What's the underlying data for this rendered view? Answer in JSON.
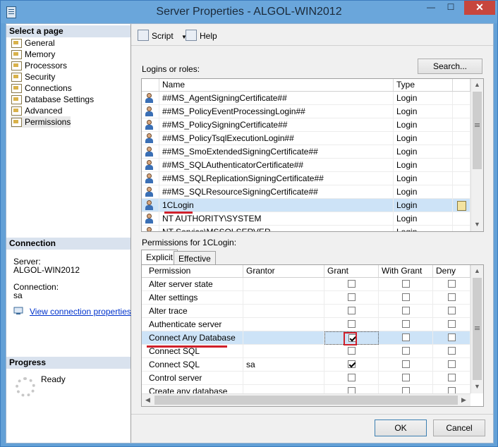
{
  "window": {
    "title": "Server Properties - ALGOL-WIN2012",
    "minimize": "—",
    "maximize": "☐",
    "close": "✕"
  },
  "left_panel": {
    "select_page_header": "Select a page",
    "pages": [
      "General",
      "Memory",
      "Processors",
      "Security",
      "Connections",
      "Database Settings",
      "Advanced",
      "Permissions"
    ],
    "selected_page": "Permissions",
    "connection_header": "Connection",
    "server_label": "Server:",
    "server_value": "ALGOL-WIN2012",
    "connection_label": "Connection:",
    "connection_value": "sa",
    "view_link": "View connection properties",
    "progress_header": "Progress",
    "progress_status": "Ready"
  },
  "toolbar": {
    "script_label": "Script",
    "help_label": "Help"
  },
  "logins": {
    "section_label": "Logins or roles:",
    "search_button": "Search...",
    "columns": [
      "Name",
      "Type"
    ],
    "rows": [
      {
        "name": "##MS_AgentSigningCertificate##",
        "type": "Login"
      },
      {
        "name": "##MS_PolicyEventProcessingLogin##",
        "type": "Login"
      },
      {
        "name": "##MS_PolicySigningCertificate##",
        "type": "Login"
      },
      {
        "name": "##MS_PolicyTsqlExecutionLogin##",
        "type": "Login"
      },
      {
        "name": "##MS_SmoExtendedSigningCertificate##",
        "type": "Login"
      },
      {
        "name": "##MS_SQLAuthenticatorCertificate##",
        "type": "Login"
      },
      {
        "name": "##MS_SQLReplicationSigningCertificate##",
        "type": "Login"
      },
      {
        "name": "##MS_SQLResourceSigningCertificate##",
        "type": "Login"
      },
      {
        "name": "1CLogin",
        "type": "Login"
      },
      {
        "name": "NT AUTHORITY\\SYSTEM",
        "type": "Login"
      },
      {
        "name": "NT Service\\MSSQLSERVER",
        "type": "Login"
      }
    ],
    "selected_row": 8
  },
  "permissions": {
    "section_label": "Permissions for 1CLogin:",
    "tabs": [
      "Explicit",
      "Effective"
    ],
    "active_tab": "Explicit",
    "columns": [
      "Permission",
      "Grantor",
      "Grant",
      "With Grant",
      "Deny"
    ],
    "rows": [
      {
        "permission": "Alter server state",
        "grantor": "",
        "grant": false,
        "with_grant": false,
        "deny": false
      },
      {
        "permission": "Alter settings",
        "grantor": "",
        "grant": false,
        "with_grant": false,
        "deny": false
      },
      {
        "permission": "Alter trace",
        "grantor": "",
        "grant": false,
        "with_grant": false,
        "deny": false
      },
      {
        "permission": "Authenticate server",
        "grantor": "",
        "grant": false,
        "with_grant": false,
        "deny": false
      },
      {
        "permission": "Connect Any Database",
        "grantor": "",
        "grant": true,
        "with_grant": false,
        "deny": false
      },
      {
        "permission": "Connect SQL",
        "grantor": "",
        "grant": false,
        "with_grant": false,
        "deny": false
      },
      {
        "permission": "Connect SQL",
        "grantor": "sa",
        "grant": true,
        "with_grant": false,
        "deny": false
      },
      {
        "permission": "Control server",
        "grantor": "",
        "grant": false,
        "with_grant": false,
        "deny": false
      },
      {
        "permission": "Create any database",
        "grantor": "",
        "grant": false,
        "with_grant": false,
        "deny": false
      }
    ],
    "selected_row": 4
  },
  "footer": {
    "ok_label": "OK",
    "cancel_label": "Cancel"
  }
}
